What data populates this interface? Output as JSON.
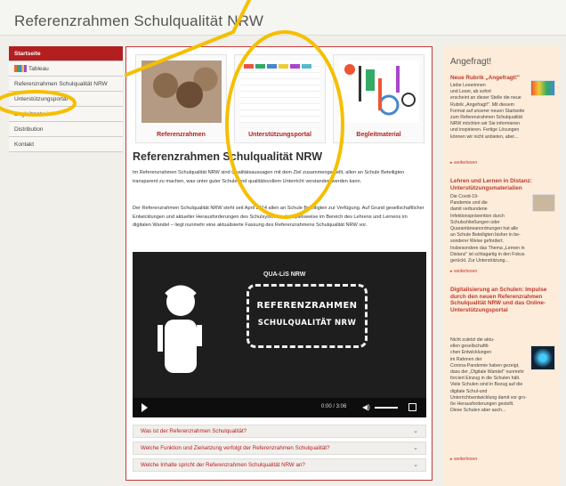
{
  "site": {
    "title": "Referenzrahmen Schulqualität NRW"
  },
  "sidebar": {
    "items": [
      {
        "label": "Startseite"
      },
      {
        "label": "Tableau"
      },
      {
        "label": "Referenzrahmen Schulqualität NRW"
      },
      {
        "label": "Unterstützungsportal"
      },
      {
        "label": "Begleitmaterial"
      },
      {
        "label": "Distribution"
      },
      {
        "label": "Kontakt"
      }
    ]
  },
  "tiles": [
    {
      "label": "Referenzrahmen"
    },
    {
      "label": "Unterstützungsportal"
    },
    {
      "label": "Begleitmaterial"
    }
  ],
  "main": {
    "heading": "Referenzrahmen Schulqualität NRW",
    "p1": "Im Referenzrahmen Schulqualität NRW sind Qualitätsaussagen mit dem Ziel zusammengestellt, allen an Schule Beteiligten transparent zu machen, was unter guter Schule und qualitätsvollem Unterricht verstanden werden kann.",
    "p2": "Der Referenzrahmen Schulqualität NRW steht seit April 2014 allen an Schule Beteiligten zur Verfügung. Auf Grund gesellschaftlicher Entwicklungen und aktueller Herausforderungen des Schulsystems – beispielsweise im Bereich des Lehrens und Lernens im digitalen Wandel – liegt nunmehr eine aktualisierte Fassung des Referenzrahmens Schulqualität NRW vor."
  },
  "video": {
    "brand": "QUA-LiS NRW",
    "board_line1": "REFERENZRAHMEN",
    "board_line2": "SCHULQUALITÄT NRW",
    "time": "0:00 / 3:06"
  },
  "accordion": [
    {
      "label": "Was ist der Referenzrahmen Schulqualität?"
    },
    {
      "label": "Welche Funktion und Zielsetzung verfolgt der Referenzrahmen Schulqualität?"
    },
    {
      "label": "Welche Inhalte spricht der Referenzrahmen Schulqualität NRW an?"
    }
  ],
  "right": {
    "title": "Angefragt!",
    "posts": [
      {
        "title": "Neue Rubrik „Angefragt!\"",
        "text": "Liebe Leserinnen\nund Leser, ab sofort\nerscheint an dieser Stelle die neue\nRubrik „Angefragt!\". Mit diesem\nFormat auf unserer neuen Startseite\nzum Referenzrahmen Schulqualität\nNRW möchten wir Sie informieren\nund inspirieren. Fertige Lösungen\nkönnen wir nicht anbieten, aber...",
        "more": "weiterlesen"
      },
      {
        "title": "Lehren und Lernen in Distanz: Unterstützungsmaterialien",
        "text": "Die Covid-19-\nPandemie und die\ndamit verbundene\nInfektionsprävention durch\nSchulschließungen oder\nQuarantäneanordnungen hat alle\nan Schule Beteiligten bisher in be-\nsonderer Weise gefordert.\nInsbesondere das Thema „Lernen in\nDistanz\" ist schlagartig in den Fokus\ngerückt. Zur Unterstützung...",
        "more": "weiterlesen"
      },
      {
        "title": "Digitalisierung an Schulen: Impulse durch den neuen Referenzrahmen Schulqualität NRW und das Online-Unterstützungsportal",
        "text": "Nicht zuletzt die aktu-\nellen gesellschaftli-\nchen Entwicklungen\nim Rahmen der\nCorona-Pandemie haben gezeigt,\ndass der „Digitale Wandel\" nunmehr\nforciert Einzug in die Schulen hält.\nViele Schulen sind in Bezug auf die\ndigitale Schul-und\nUnterrichtsentwicklung damit vor gro-\nße Herausforderungen gestellt.\nDiese Schulen aber auch...",
        "more": "weiterlesen"
      }
    ]
  }
}
